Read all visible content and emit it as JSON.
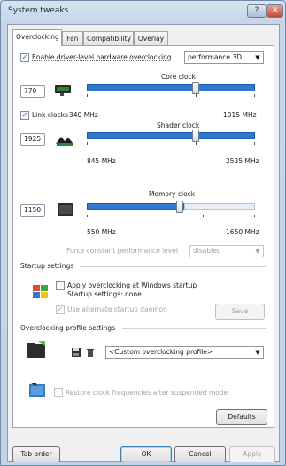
{
  "window": {
    "title": "System tweaks"
  },
  "tabs": [
    {
      "label": "Overclocking",
      "active": true
    },
    {
      "label": "Fan",
      "active": false
    },
    {
      "label": "Compatibility",
      "active": false
    },
    {
      "label": "Overlay",
      "active": false
    }
  ],
  "overclocking": {
    "enable_label": "Enable driver-level hardware overclocking",
    "enable_checked": true,
    "mode_value": "performance 3D",
    "core": {
      "title": "Core clock",
      "value": "770",
      "min_label": "340 MHz",
      "max_label": "1015 MHz",
      "level": 0.64
    },
    "link_clocks_label": "Link clocks",
    "link_clocks_checked": true,
    "shader": {
      "title": "Shader clock",
      "value": "1925",
      "min_label": "845 MHz",
      "max_label": "2535 MHz",
      "level": 0.64
    },
    "memory": {
      "title": "Memory clock",
      "value": "1150",
      "min_label": "550 MHz",
      "max_label": "1650 MHz",
      "level": 0.55
    },
    "force_label": "Force constant performance level",
    "force_value": "disabled"
  },
  "startup": {
    "group_label": "Startup settings",
    "apply_label": "Apply overclocking at Windows startup",
    "apply_sub": "Startup settings: none",
    "apply_checked": false,
    "alt_daemon_label": "Use alternate startup daemon",
    "alt_daemon_checked": true,
    "save_label": "Save"
  },
  "profile": {
    "group_label": "Overclocking profile settings",
    "value": "<Custom overclocking profile>"
  },
  "restore_label": "Restore clock frequencies after suspended mode",
  "defaults_label": "Defaults",
  "footer": {
    "tab_order": "Tab order",
    "ok": "OK",
    "cancel": "Cancel",
    "apply": "Apply"
  }
}
